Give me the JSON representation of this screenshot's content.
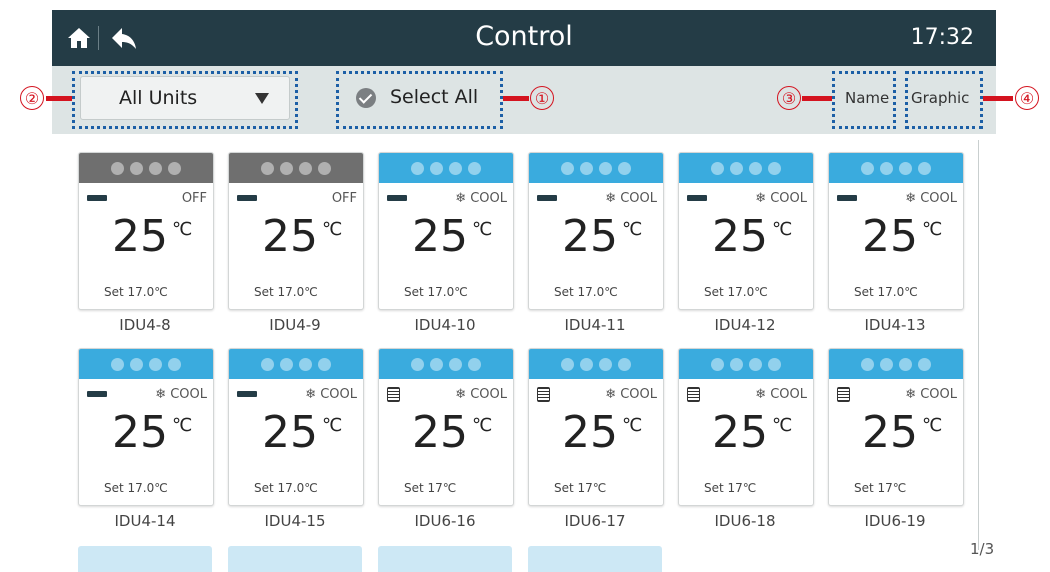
{
  "header": {
    "title": "Control",
    "time": "17:32"
  },
  "toolbar": {
    "dropdown_value": "All Units",
    "select_all_label": "Select All",
    "name_label": "Name",
    "graphic_label": "Graphic"
  },
  "callouts": [
    "①",
    "②",
    "③",
    "④"
  ],
  "colors": {
    "header_bg": "#243c46",
    "status_on": "#3aabde",
    "status_off": "#6f6f6f",
    "callout": "#d4131f",
    "dotted_box": "#1c5fa6"
  },
  "units": [
    {
      "name": "IDU4-8",
      "status": "off",
      "fan_icon": "fan-bar",
      "mode": "OFF",
      "temp": "25",
      "temp_unit": "℃",
      "set": "Set  17.0℃"
    },
    {
      "name": "IDU4-9",
      "status": "off",
      "fan_icon": "fan-bar",
      "mode": "OFF",
      "temp": "25",
      "temp_unit": "℃",
      "set": "Set  17.0℃"
    },
    {
      "name": "IDU4-10",
      "status": "on",
      "fan_icon": "fan-bar",
      "mode": "❄ COOL",
      "temp": "25",
      "temp_unit": "℃",
      "set": "Set  17.0℃"
    },
    {
      "name": "IDU4-11",
      "status": "on",
      "fan_icon": "fan-bar",
      "mode": "❄ COOL",
      "temp": "25",
      "temp_unit": "℃",
      "set": "Set  17.0℃"
    },
    {
      "name": "IDU4-12",
      "status": "on",
      "fan_icon": "fan-bar",
      "mode": "❄ COOL",
      "temp": "25",
      "temp_unit": "℃",
      "set": "Set  17.0℃"
    },
    {
      "name": "IDU4-13",
      "status": "on",
      "fan_icon": "fan-bar",
      "mode": "❄ COOL",
      "temp": "25",
      "temp_unit": "℃",
      "set": "Set  17.0℃"
    },
    {
      "name": "IDU4-14",
      "status": "on",
      "fan_icon": "fan-bar",
      "mode": "❄ COOL",
      "temp": "25",
      "temp_unit": "℃",
      "set": "Set  17.0℃"
    },
    {
      "name": "IDU4-15",
      "status": "on",
      "fan_icon": "fan-bar",
      "mode": "❄ COOL",
      "temp": "25",
      "temp_unit": "℃",
      "set": "Set  17.0℃"
    },
    {
      "name": "IDU6-16",
      "status": "on",
      "fan_icon": "louver",
      "mode": "❄ COOL",
      "temp": "25",
      "temp_unit": "℃",
      "set": "Set  17℃"
    },
    {
      "name": "IDU6-17",
      "status": "on",
      "fan_icon": "louver",
      "mode": "❄ COOL",
      "temp": "25",
      "temp_unit": "℃",
      "set": "Set  17℃"
    },
    {
      "name": "IDU6-18",
      "status": "on",
      "fan_icon": "louver",
      "mode": "❄ COOL",
      "temp": "25",
      "temp_unit": "℃",
      "set": "Set  17℃"
    },
    {
      "name": "IDU6-19",
      "status": "on",
      "fan_icon": "louver",
      "mode": "❄ COOL",
      "temp": "25",
      "temp_unit": "℃",
      "set": "Set  17℃"
    }
  ],
  "pagination": "1/3"
}
